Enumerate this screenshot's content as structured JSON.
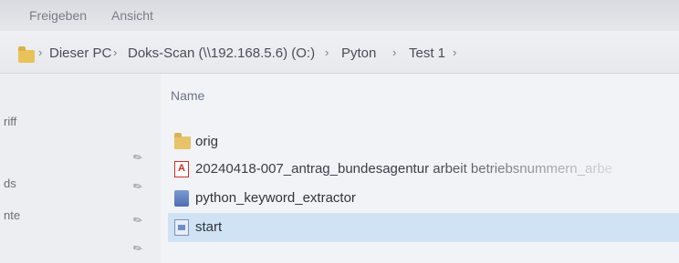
{
  "ribbon": {
    "tabs": [
      "Freigeben",
      "Ansicht"
    ]
  },
  "address_bar": {
    "breadcrumb": [
      "Dieser PC",
      "Doks-Scan (\\\\192.168.5.6) (O:)",
      "Pyton",
      "Test 1"
    ]
  },
  "nav_pane": {
    "items": [
      {
        "label": "riff"
      },
      {
        "label": "ds"
      },
      {
        "label": "nte"
      }
    ]
  },
  "file_list": {
    "column_header": "Name",
    "rows": [
      {
        "name": "orig",
        "icon": "folder-icon"
      },
      {
        "name": "20240418-007_antrag_bundesagentur arbeit betriebsnummern_arbe",
        "icon": "pdf-icon"
      },
      {
        "name": "python_keyword_extractor",
        "icon": "python-file-icon"
      },
      {
        "name": "start",
        "icon": "batch-file-icon",
        "selected": true
      }
    ]
  },
  "colors": {
    "selection": "#cfe3f5",
    "folder": "#e7c46a",
    "pdf_red": "#d12b2b"
  }
}
